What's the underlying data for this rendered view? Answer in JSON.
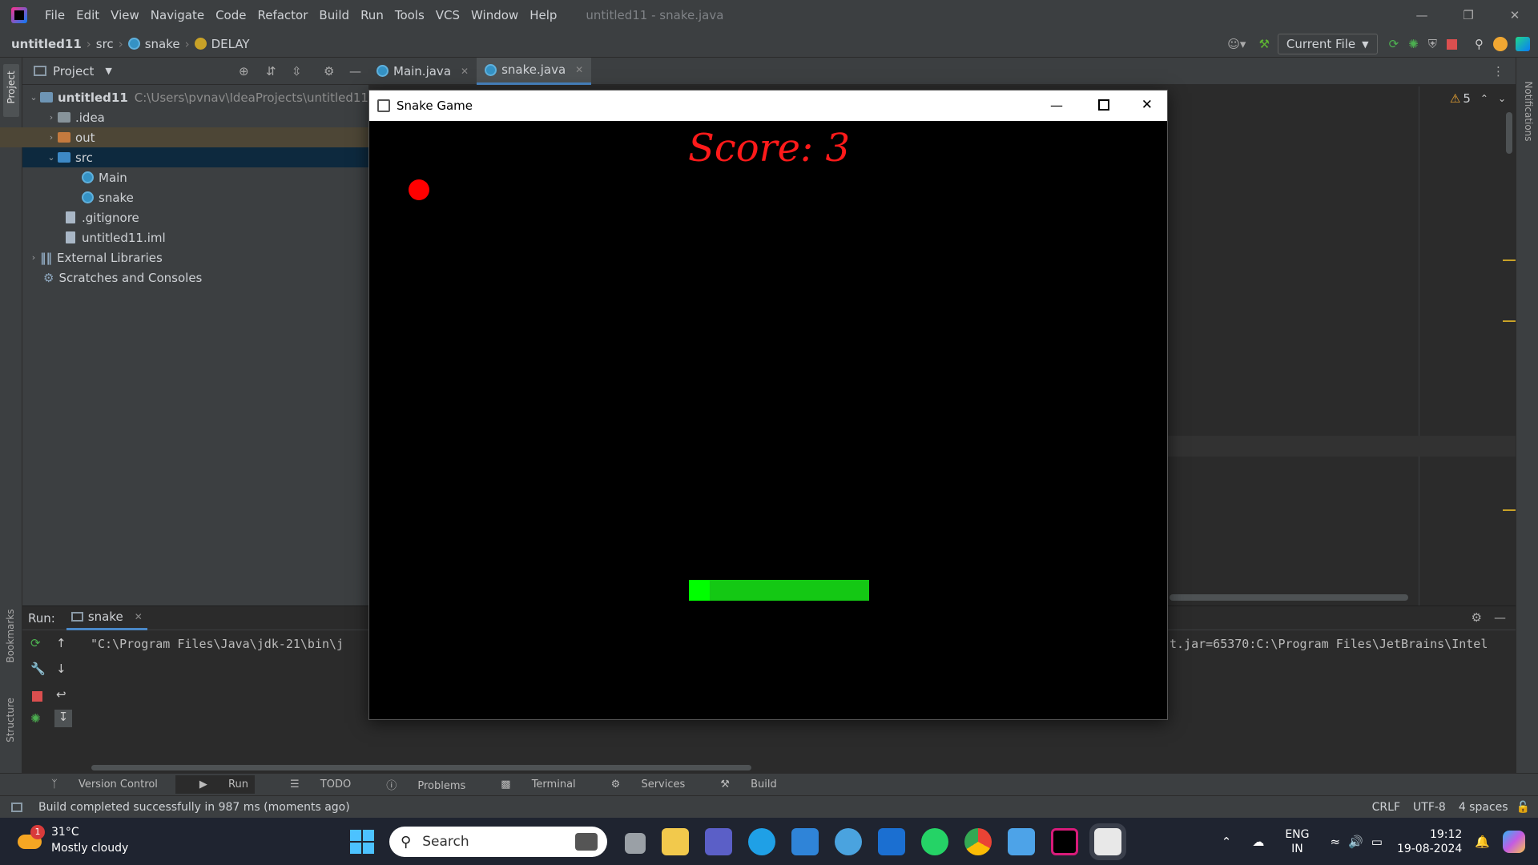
{
  "menu": [
    "File",
    "Edit",
    "View",
    "Navigate",
    "Code",
    "Refactor",
    "Build",
    "Run",
    "Tools",
    "VCS",
    "Window",
    "Help"
  ],
  "window_title": "untitled11 - snake.java",
  "breadcrumb": [
    "untitled11",
    "src",
    "snake",
    "DELAY"
  ],
  "run_config": "Current File",
  "project_panel": {
    "title": "Project"
  },
  "tree": {
    "root": {
      "label": "untitled11",
      "path": "C:\\Users\\pvnav\\IdeaProjects\\untitled11"
    },
    "idea": ".idea",
    "out": "out",
    "src": "src",
    "main": "Main",
    "snake": "snake",
    "gitignore": ".gitignore",
    "iml": "untitled11.iml",
    "ext_libs": "External Libraries",
    "scratches": "Scratches and Consoles"
  },
  "editor_tabs": [
    "Main.java",
    "snake.java"
  ],
  "warnings_count": "5",
  "run_panel": {
    "label": "Run:",
    "tab": "snake",
    "console_left": "\"C:\\Program Files\\Java\\jdk-21\\bin\\j",
    "console_right": "t.jar=65370:C:\\Program Files\\JetBrains\\Intel"
  },
  "tool_windows": [
    "Version Control",
    "Run",
    "TODO",
    "Problems",
    "Terminal",
    "Services",
    "Build"
  ],
  "side_labels": {
    "left_top": "Project",
    "left_mid": "Bookmarks",
    "left_bot": "Structure",
    "right": "Notifications"
  },
  "status": {
    "message": "Build completed successfully in 987 ms (moments ago)",
    "line_ending": "CRLF",
    "encoding": "UTF-8",
    "indent": "4 spaces"
  },
  "game": {
    "title": "Snake Game",
    "score_text": "Score: 3",
    "score": 3
  },
  "taskbar": {
    "weather_temp": "31°C",
    "weather_desc": "Mostly cloudy",
    "weather_badge": "1",
    "search_placeholder": "Search",
    "lang": "ENG",
    "region": "IN",
    "time": "19:12",
    "date": "19-08-2024"
  },
  "colors": {
    "food": "#ff0000",
    "snake_head": "#00ff00",
    "snake_body": "#14c814",
    "score": "#ff1a1a"
  }
}
